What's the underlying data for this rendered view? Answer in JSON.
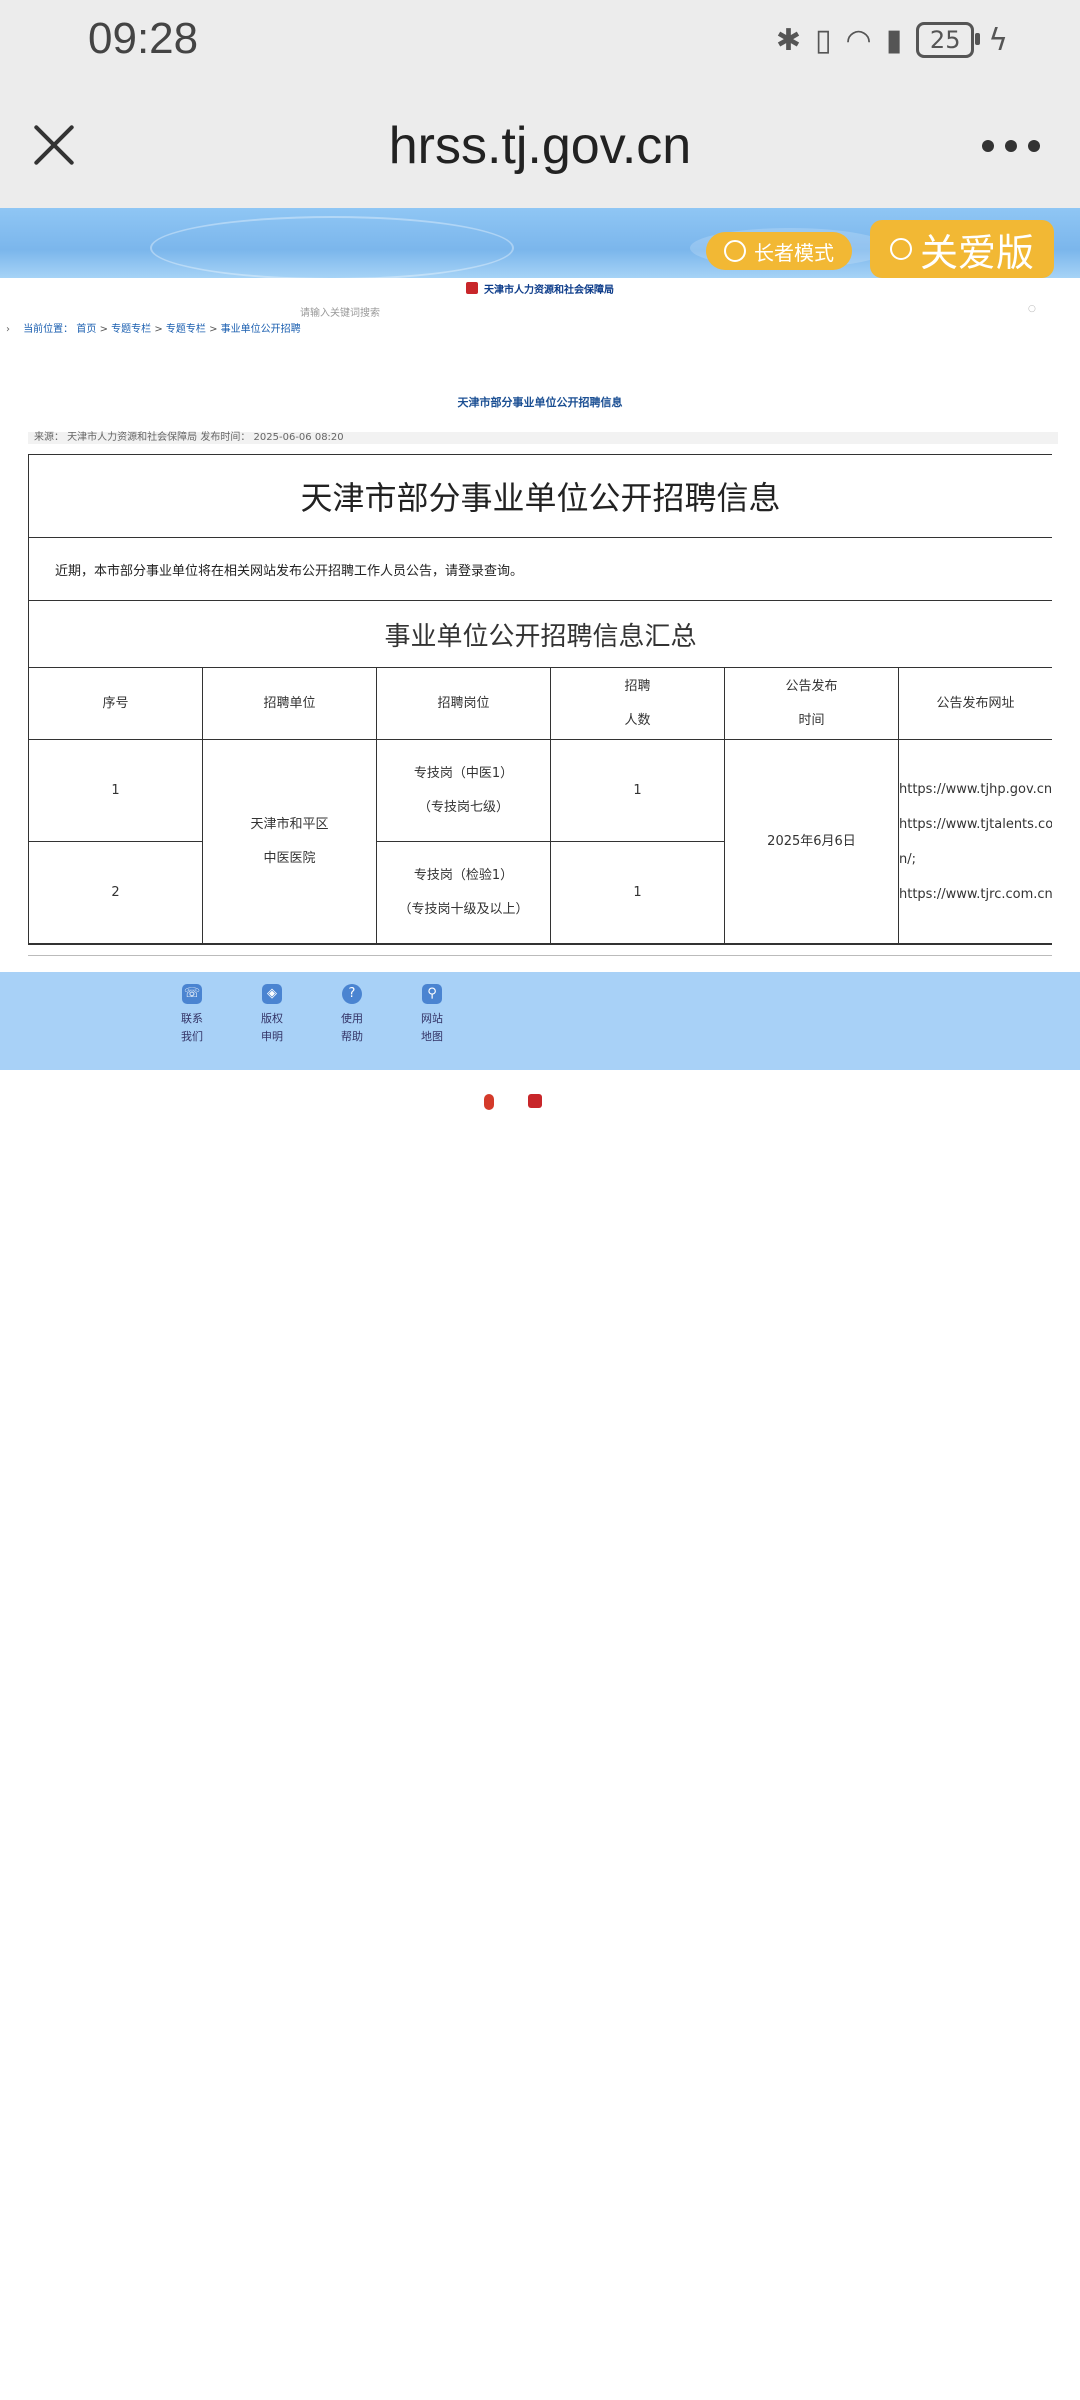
{
  "status_bar": {
    "time": "09:28",
    "battery": "25"
  },
  "browser": {
    "url": "hrss.tj.gov.cn"
  },
  "banner": {
    "elder_mode": "长者模式",
    "care_version": "关爱版"
  },
  "site": {
    "logo_text": "天津市人力资源和社会保障局",
    "search_placeholder": "请输入关键词搜索"
  },
  "breadcrumb": {
    "label": "当前位置：",
    "items": [
      "首页",
      "专题专栏",
      "专题专栏",
      "事业单位公开招聘"
    ],
    "separator": ">"
  },
  "article": {
    "title": "天津市部分事业单位公开招聘信息",
    "meta": "来源：  天津市人力资源和社会保障局  发布时间：  2025-06-06 08:20",
    "heading": "天津市部分事业单位公开招聘信息",
    "notice": "近期，本市部分事业单位将在相关网站发布公开招聘工作人员公告，请登录查询。",
    "summary_title": "事业单位公开招聘信息汇总"
  },
  "table": {
    "headers": [
      "序号",
      "招聘单位",
      "招聘岗位",
      "招聘\n人数",
      "公告发布\n时间",
      "公告发布网址"
    ],
    "unit": "天津市和平区\n中医医院",
    "date": "2025年6月6日",
    "urls": "https://www.tjhp.gov.cn/;\nhttps://www.tjtalents.com\nn/;\nhttps://www.tjrc.com.cn/",
    "rows": [
      {
        "no": "1",
        "post": "专技岗（中医1）\n（专技岗七级）",
        "count": "1"
      },
      {
        "no": "2",
        "post": "专技岗（检验1）\n（专技岗十级及以上）",
        "count": "1"
      }
    ]
  },
  "footer": {
    "items": [
      {
        "label": "联系\n我们",
        "icon": "phone-icon"
      },
      {
        "label": "版权\n申明",
        "icon": "shield-icon"
      },
      {
        "label": "使用\n帮助",
        "icon": "help-icon"
      },
      {
        "label": "网站\n地图",
        "icon": "sitemap-icon"
      }
    ]
  },
  "colors": {
    "accent_yellow": "#f2b834",
    "banner_blue": "#8fc6f4",
    "footer_blue": "#a8d1f7",
    "link_blue": "#1b5fb0"
  }
}
